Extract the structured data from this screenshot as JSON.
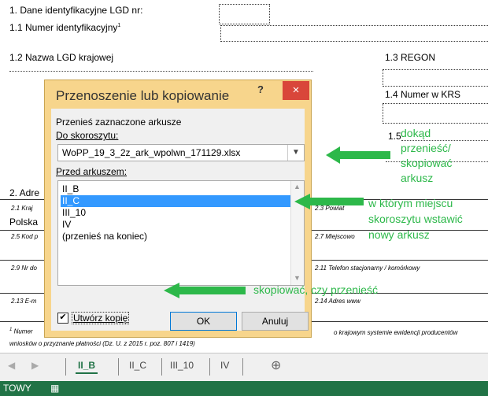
{
  "form": {
    "l1": "1. Dane identyfikacyjne LGD nr:",
    "l11": "1.1 Numer identyfikacyjny",
    "l11_sup": "1",
    "l12": "1.2 Nazwa LGD krajowej",
    "l13": "1.3 REGON",
    "l14": "1.4 Numer w KRS",
    "l15": "1.5",
    "l2": "2. Adre",
    "l21": "2.1 Kraj",
    "l23": "2.3 Powiat",
    "polska": "Polska",
    "l25": "2.5 Kod p",
    "l27": "2.7 Miejscowo",
    "l29": "2.9 Nr do",
    "l211": "2.11 Telefon stacjonarny / komórkowy",
    "l213": "2.13 E-m",
    "l214": "2.14 Adres www",
    "foot_sup": "1",
    "foot_a": "Numer",
    "foot_b": "o krajowym systemie ewidencji producentów",
    "foot_c": "wniosków o przyznanie płatności (Dz. U. z 2015 r. poz. 807 i 1419)"
  },
  "tabs": [
    "II_B",
    "II_C",
    "III_10",
    "IV"
  ],
  "active_tab": "II_B",
  "status": {
    "mode": "TOWY"
  },
  "dialog": {
    "title": "Przenoszenie lub kopiowanie",
    "help": "?",
    "close": "×",
    "move_label": "Przenieś zaznaczone arkusze",
    "book_label": "Do skoroszytu:",
    "book_value": "WoPP_19_3_2z_ark_wpolwn_171129.xlsx",
    "before_label": "Przed arkuszem:",
    "sheets": [
      "II_B",
      "II_C",
      "III_10",
      "IV",
      "(przenieś na koniec)"
    ],
    "selected_sheet": "II_C",
    "copy_label": "Utwórz kopię",
    "copy_checked": true,
    "ok": "OK",
    "cancel": "Anuluj"
  },
  "annotations": {
    "a1": [
      "dokąd",
      "przenieść/",
      "skopiować",
      "arkusz"
    ],
    "a2": [
      "w którym miejscu",
      "skoroszytu wstawić",
      "nowy arkusz"
    ],
    "a3": "skopiować, czy przenieść"
  },
  "colors": {
    "annotation": "#2db84a",
    "dialog_frame": "#f7d58c",
    "selection": "#3399ff",
    "status_bar": "#217346",
    "close": "#d9463a"
  }
}
